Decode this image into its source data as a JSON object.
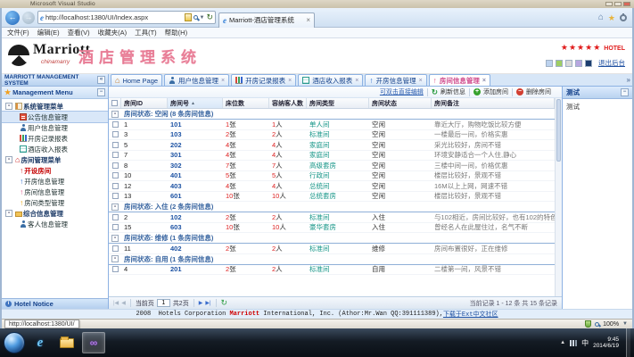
{
  "background_window": {
    "title": "Microsoft Visual Studio"
  },
  "browser": {
    "url": "http://localhost:1380/UI/Index.aspx",
    "tab_title": "Marriott-酒店管理系统",
    "menu_items": [
      "文件(F)",
      "编辑(E)",
      "查看(V)",
      "收藏夹(A)",
      "工具(T)",
      "帮助(H)"
    ]
  },
  "header": {
    "logo_text": "Marriott",
    "logo_sub": "chinamarry",
    "title": "酒店管理系统",
    "stars": "★★★★★",
    "stars_label": "HOTEL",
    "theme_swatches": [
      "#bcd2ee",
      "#9fce63",
      "#d9d9d9",
      "#b7a7e0",
      "#1c3d6e"
    ],
    "logout_link": "退出后台"
  },
  "sidebar": {
    "system_title": "MARRIOTT MANAGEMENT SYSTEM",
    "menu_title": "Management Menu",
    "groups": [
      {
        "label": "系统管理菜单",
        "icon": "notebook-icon",
        "items": [
          {
            "label": "公告信息管理",
            "icon": "bulletin-icon",
            "selected": true
          },
          {
            "label": "用户信息管理",
            "icon": "user-icon"
          },
          {
            "label": "开房记录报表",
            "icon": "chart-icon"
          },
          {
            "label": "酒店收入报表",
            "icon": "table-icon"
          }
        ]
      },
      {
        "label": "房间管理菜单",
        "icon": "house-icon",
        "items": [
          {
            "label": "开设房间",
            "icon": "arrow-red-icon",
            "red": true
          },
          {
            "label": "开房信息管理",
            "icon": "arrow-blue-icon"
          },
          {
            "label": "房间信息管理",
            "icon": "arrow-pink-icon"
          },
          {
            "label": "房间类型管理",
            "icon": "arrow-yellow-icon"
          }
        ]
      },
      {
        "label": "综合信息管理",
        "icon": "folder-icon",
        "items": [
          {
            "label": "客人信息管理",
            "icon": "user-icon"
          }
        ]
      }
    ],
    "bottom_bar": "Hotel Notice"
  },
  "tabs": [
    {
      "label": "Home Page",
      "icon": "home-icon",
      "closable": false,
      "active": false
    },
    {
      "label": "用户信息管理",
      "icon": "user-icon",
      "closable": true,
      "active": false
    },
    {
      "label": "开房记录报表",
      "icon": "chart-icon",
      "closable": true,
      "active": false
    },
    {
      "label": "酒店收入报表",
      "icon": "table-icon",
      "closable": true,
      "active": false
    },
    {
      "label": "开房信息管理",
      "icon": "arrow-blue-icon",
      "closable": true,
      "active": false
    },
    {
      "label": "房间信息管理",
      "icon": "arrow-pink-icon",
      "closable": true,
      "active": true
    }
  ],
  "toolbar": {
    "hint": "可双击直接编辑",
    "buttons": [
      {
        "label": "刷新信息",
        "icon": "refresh-icon"
      },
      {
        "label": "添加房间",
        "icon": "add-icon"
      },
      {
        "label": "删除房间",
        "icon": "delete-icon"
      }
    ]
  },
  "grid": {
    "columns": [
      "房间ID",
      "房间号",
      "床位数",
      "容纳客人数",
      "房间类型",
      "房间状态",
      "房间备注"
    ],
    "beds_unit": "张",
    "guests_unit": "人",
    "groups": [
      {
        "header": "房间状态: 空闲 (8 条房间信息)",
        "rows": [
          {
            "id": "1",
            "room": "101",
            "beds": "1",
            "guests": "1",
            "type": "单人间",
            "status": "空闲",
            "remark": "靠近大厅，购物吃饭比较方便"
          },
          {
            "id": "3",
            "room": "103",
            "beds": "2",
            "guests": "2",
            "type": "标准间",
            "status": "空闲",
            "remark": "一楼最后一间，价格实惠"
          },
          {
            "id": "5",
            "room": "202",
            "beds": "4",
            "guests": "4",
            "type": "家庭间",
            "status": "空闲",
            "remark": "采光比较好，房间不错"
          },
          {
            "id": "7",
            "room": "301",
            "beds": "4",
            "guests": "4",
            "type": "家庭间",
            "status": "空闲",
            "remark": "环境安静适合一个人住,静心"
          },
          {
            "id": "8",
            "room": "302",
            "beds": "7",
            "guests": "7",
            "type": "高级套房",
            "status": "空闲",
            "remark": "三楼中间一间，价格优惠"
          },
          {
            "id": "10",
            "room": "401",
            "beds": "5",
            "guests": "5",
            "type": "行政间",
            "status": "空闲",
            "remark": "楼层比较好，景观不错"
          },
          {
            "id": "12",
            "room": "403",
            "beds": "4",
            "guests": "4",
            "type": "总统间",
            "status": "空闲",
            "remark": "16M以上上网，网速不错"
          },
          {
            "id": "13",
            "room": "601",
            "beds": "10",
            "guests": "10",
            "type": "总统套房",
            "status": "空闲",
            "remark": "楼层比较好，景观不错"
          }
        ]
      },
      {
        "header": "房间状态: 入住 (2 条房间信息)",
        "rows": [
          {
            "id": "2",
            "room": "102",
            "beds": "2",
            "guests": "2",
            "type": "标准间",
            "status": "入住",
            "remark": "与102相近，房间比较好，也有102的特色"
          },
          {
            "id": "15",
            "room": "603",
            "beds": "10",
            "guests": "10",
            "type": "豪华套房",
            "status": "入住",
            "remark": "曾经名人在此屋住过，名气不断"
          }
        ]
      },
      {
        "header": "房间状态: 维修 (1 条房间信息)",
        "rows": [
          {
            "id": "11",
            "room": "402",
            "beds": "2",
            "guests": "2",
            "type": "标准间",
            "status": "维修",
            "remark": "房间布置很好，正在维修"
          }
        ]
      },
      {
        "header": "房间状态: 自用 (1 条房间信息)",
        "rows": [
          {
            "id": "4",
            "room": "201",
            "beds": "2",
            "guests": "2",
            "type": "标准间",
            "status": "自用",
            "remark": "二楼第一间，风景不错"
          }
        ]
      }
    ]
  },
  "pagination": {
    "page_label": "当前页",
    "page_value": "1",
    "total_label": "共2页",
    "status": "当前记录 1 - 12 条 共 15 条记录"
  },
  "right_panel": {
    "title": "测试",
    "body": "测试"
  },
  "footer": {
    "year_prefix": "2008  Hotels Corporation ",
    "brand": "Marriott",
    "suffix": " International, Inc. (Athor:Mr.Wan QQ:391111389),",
    "link": "下载于Ext中文社区"
  },
  "status_bar": {
    "url": "http://localhost:1380/UI/",
    "zoom": "100%"
  },
  "taskbar": {
    "input_indicator": "中",
    "clock_time": "9:45",
    "clock_date": "2014/6/19"
  }
}
